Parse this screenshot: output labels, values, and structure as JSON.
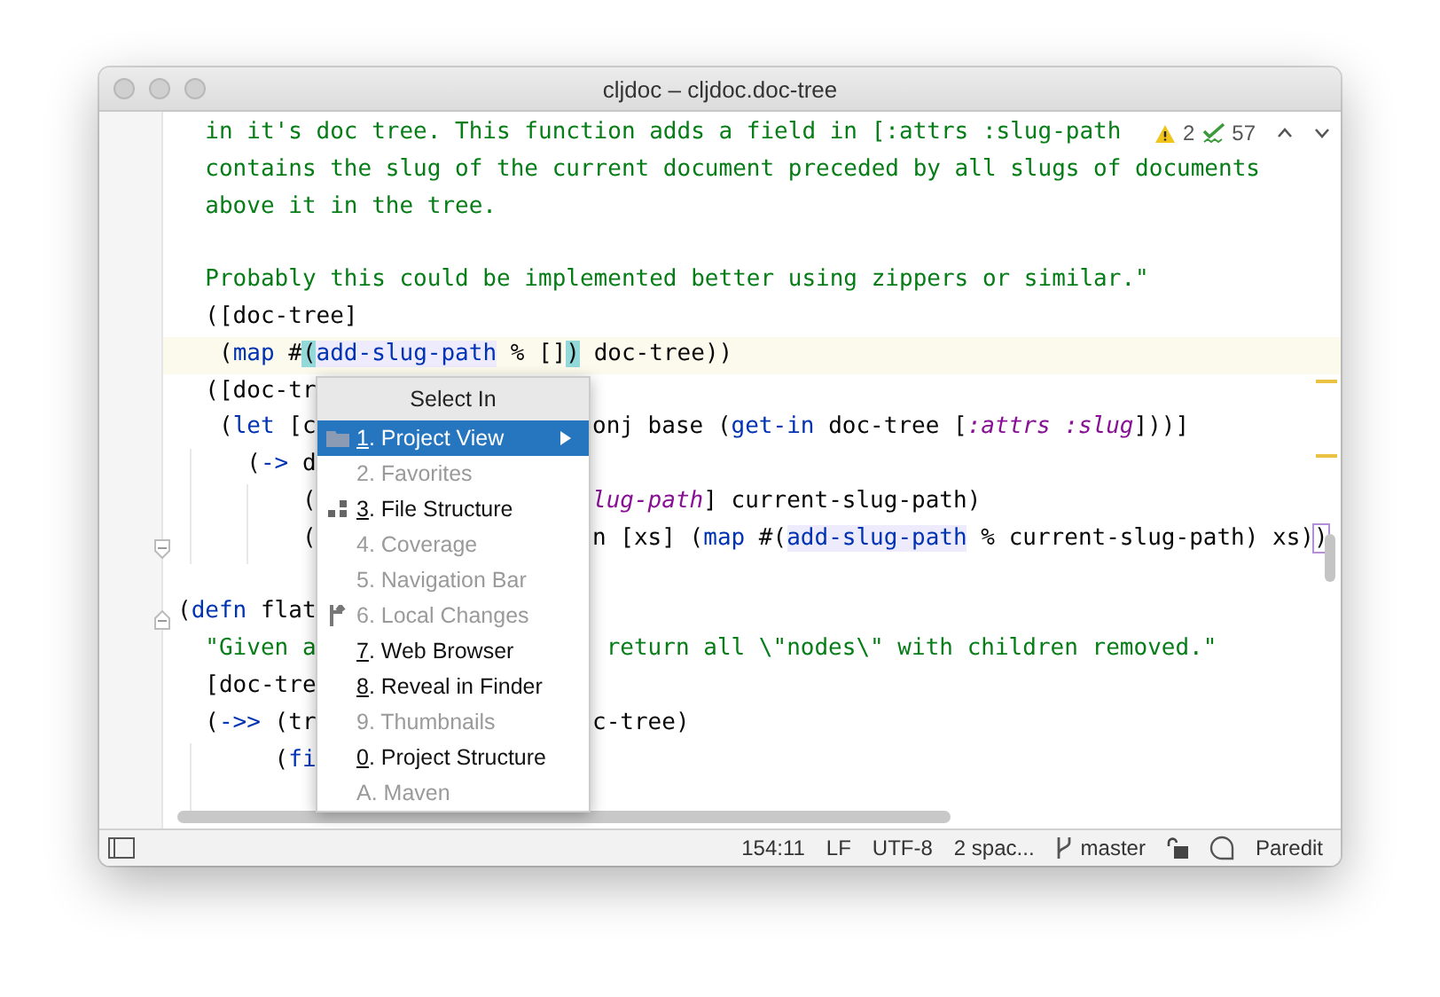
{
  "window": {
    "title": "cljdoc – cljdoc.doc-tree"
  },
  "inspections": {
    "warnings": "2",
    "checks": "57"
  },
  "lines": [
    {
      "kind": "full",
      "current": false,
      "left": [
        {
          "t": "  in it's doc tree. This function adds a field in [:attrs :slug-path",
          "kind": "string"
        }
      ]
    },
    {
      "kind": "full",
      "current": false,
      "left": [
        {
          "t": "  contains the slug of the current document preceded by all slugs of documents",
          "kind": "string"
        }
      ]
    },
    {
      "kind": "full",
      "current": false,
      "left": [
        {
          "t": "  above it in the tree.",
          "kind": "string"
        }
      ]
    },
    {
      "kind": "blank",
      "current": false
    },
    {
      "kind": "full",
      "current": false,
      "left": [
        {
          "t": "  Probably this could be implemented better using zippers or similar.\"",
          "kind": "string"
        }
      ]
    },
    {
      "kind": "full",
      "current": false,
      "left": [
        {
          "t": "  ([doc-tree]",
          "kind": "plain"
        }
      ]
    },
    {
      "kind": "full",
      "current": true,
      "left": [
        {
          "t": "   (",
          "kind": "plain"
        },
        {
          "t": "map",
          "kind": "keyword"
        },
        {
          "t": " #",
          "kind": "plain"
        },
        {
          "t": "(",
          "kind": "paren"
        },
        {
          "t": "add-slug-path",
          "kind": "usage"
        },
        {
          "t": " % []",
          "kind": "plain"
        },
        {
          "t": ")",
          "kind": "paren"
        },
        {
          "t": " doc-tree))",
          "kind": "plain"
        }
      ]
    },
    {
      "kind": "split",
      "current": false,
      "left": [
        {
          "t": "  ([doc-tr",
          "kind": "plain"
        }
      ]
    },
    {
      "kind": "split",
      "current": false,
      "left": [
        {
          "t": "   (",
          "kind": "plain"
        },
        {
          "t": "let",
          "kind": "keyword"
        },
        {
          "t": " [c",
          "kind": "plain"
        }
      ],
      "right": [
        {
          "t": "onj base (",
          "kind": "plain"
        },
        {
          "t": "get-in",
          "kind": "keyword"
        },
        {
          "t": " doc-tree [",
          "kind": "plain"
        },
        {
          "t": ":attrs :slug",
          "kind": "symbol"
        },
        {
          "t": "]))]",
          "kind": "plain"
        }
      ]
    },
    {
      "kind": "split",
      "current": false,
      "left": [
        {
          "t": "     (",
          "kind": "plain"
        },
        {
          "t": "->",
          "kind": "keyword"
        },
        {
          "t": " d",
          "kind": "plain"
        }
      ]
    },
    {
      "kind": "split",
      "current": false,
      "left": [
        {
          "t": "         (",
          "kind": "plain"
        }
      ],
      "right": [
        {
          "t": "lug-path",
          "kind": "symbol"
        },
        {
          "t": "] current-slug-path)",
          "kind": "plain"
        }
      ]
    },
    {
      "kind": "split",
      "current": false,
      "left": [
        {
          "t": "         (",
          "kind": "plain"
        }
      ],
      "right": [
        {
          "t": "n [xs] (",
          "kind": "plain"
        },
        {
          "t": "map",
          "kind": "keyword"
        },
        {
          "t": " #(",
          "kind": "plain"
        },
        {
          "t": "add-slug-path",
          "kind": "usage"
        },
        {
          "t": " % current-slug-path) xs)",
          "kind": "plain"
        },
        {
          "t": ")",
          "kind": "mark"
        }
      ]
    },
    {
      "kind": "blank",
      "current": false
    },
    {
      "kind": "split",
      "current": false,
      "left": [
        {
          "t": "(",
          "kind": "plain"
        },
        {
          "t": "defn",
          "kind": "keyword"
        },
        {
          "t": " flat",
          "kind": "plain"
        }
      ]
    },
    {
      "kind": "split",
      "current": false,
      "left": [
        {
          "t": "  \"Given a",
          "kind": "string"
        }
      ],
      "right": [
        {
          "t": " return all \\\"nodes\\\" with children removed.\"",
          "kind": "string"
        }
      ]
    },
    {
      "kind": "split",
      "current": false,
      "left": [
        {
          "t": "  [doc-tre",
          "kind": "plain"
        }
      ]
    },
    {
      "kind": "split",
      "current": false,
      "left": [
        {
          "t": "  (",
          "kind": "plain"
        },
        {
          "t": "->>",
          "kind": "keyword"
        },
        {
          "t": " (tr",
          "kind": "plain"
        }
      ],
      "right": [
        {
          "t": "c-tree)",
          "kind": "plain"
        }
      ]
    },
    {
      "kind": "split",
      "current": false,
      "left": [
        {
          "t": "       (",
          "kind": "plain"
        },
        {
          "t": "fi",
          "kind": "keyword"
        }
      ]
    }
  ],
  "popup": {
    "title": "Select In",
    "items": [
      {
        "text": "1. Project View",
        "selected": true,
        "disabled": false,
        "kind": "folder",
        "submenu": true
      },
      {
        "text": "2. Favorites",
        "selected": false,
        "disabled": true
      },
      {
        "text": "3. File Structure",
        "selected": false,
        "disabled": false,
        "kind": "structure"
      },
      {
        "text": "4. Coverage",
        "selected": false,
        "disabled": true
      },
      {
        "text": "5. Navigation Bar",
        "selected": false,
        "disabled": true
      },
      {
        "text": "6. Local Changes",
        "selected": false,
        "disabled": true,
        "kind": "changes"
      },
      {
        "text": "7. Web Browser",
        "selected": false,
        "disabled": false
      },
      {
        "text": "8. Reveal in Finder",
        "selected": false,
        "disabled": false
      },
      {
        "text": "9. Thumbnails",
        "selected": false,
        "disabled": true
      },
      {
        "text": "0. Project Structure",
        "selected": false,
        "disabled": false
      },
      {
        "text": "A. Maven",
        "selected": false,
        "disabled": true
      }
    ]
  },
  "status_bar": {
    "position": "154:11",
    "line_separator": "LF",
    "encoding": "UTF-8",
    "indent": "2 spac...",
    "branch": "master",
    "mode": "Paredit"
  }
}
